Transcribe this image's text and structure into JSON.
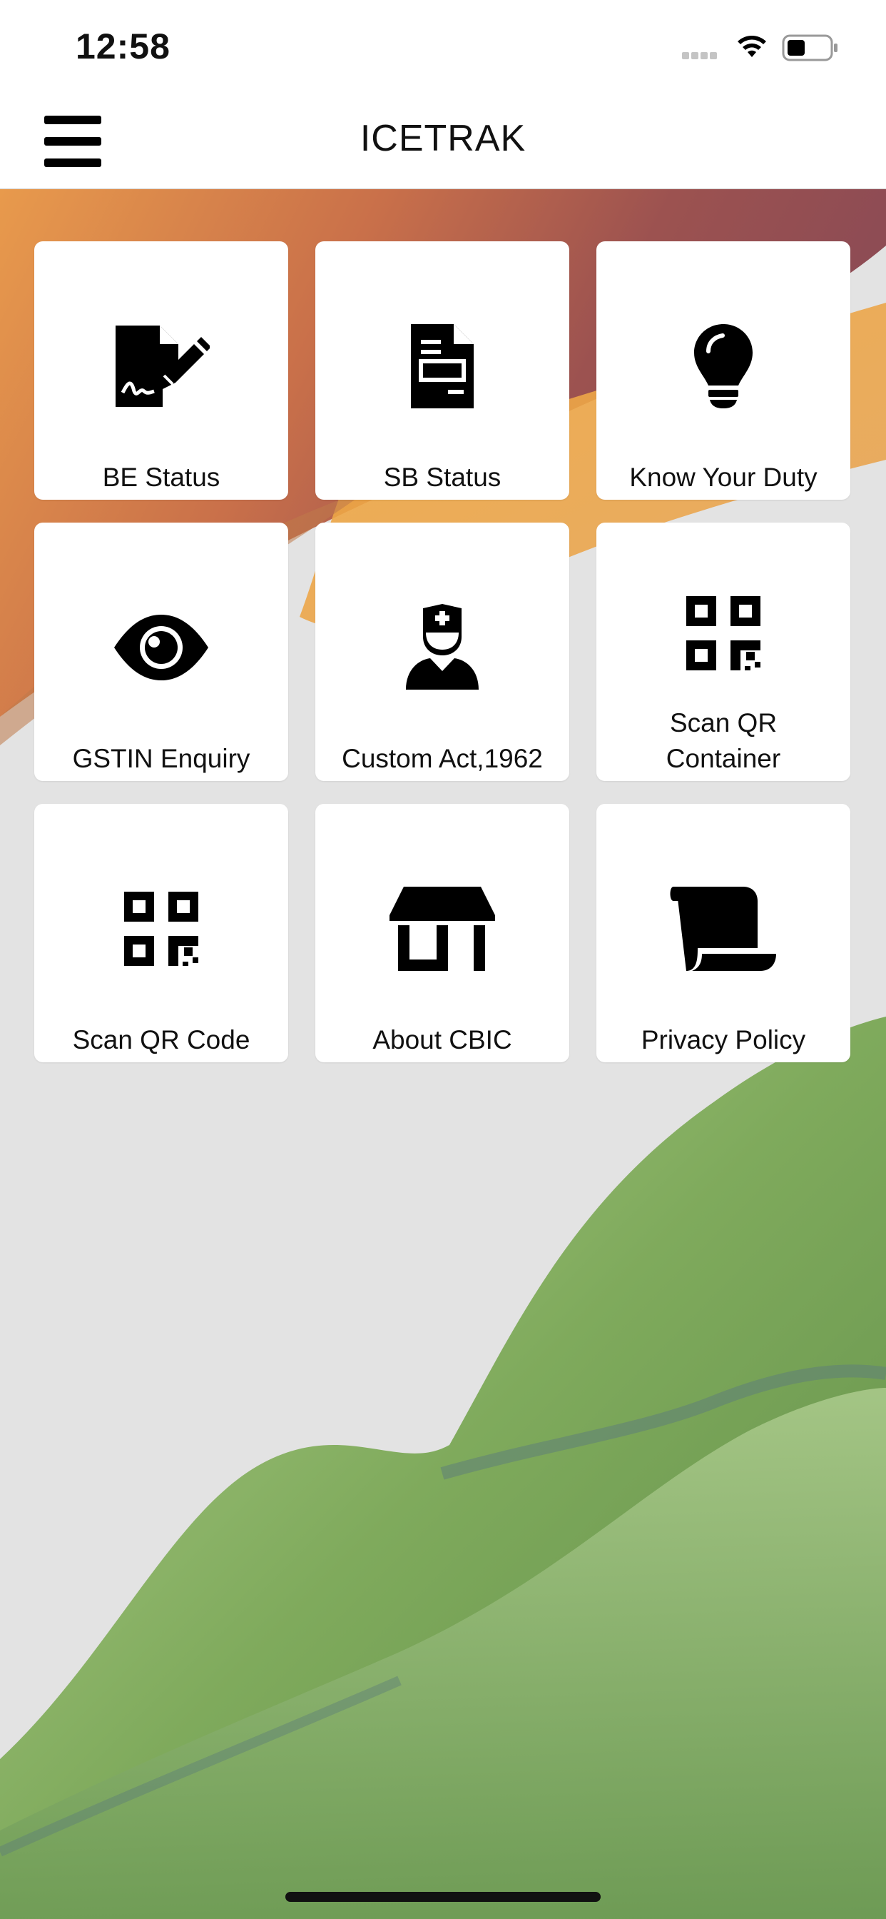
{
  "status_bar": {
    "time": "12:58"
  },
  "header": {
    "title": "ICETRAK"
  },
  "tiles": [
    {
      "label": "BE Status",
      "icon": "file-signature-icon"
    },
    {
      "label": "SB Status",
      "icon": "document-icon"
    },
    {
      "label": "Know Your Duty",
      "icon": "lightbulb-icon"
    },
    {
      "label": "GSTIN Enquiry",
      "icon": "eye-icon"
    },
    {
      "label": "Custom Act,1962",
      "icon": "user-nurse-icon"
    },
    {
      "label": "Scan QR Container",
      "icon": "qrcode-icon"
    },
    {
      "label": "Scan QR Code",
      "icon": "qrcode-icon"
    },
    {
      "label": "About CBIC",
      "icon": "store-icon"
    },
    {
      "label": "Privacy Policy",
      "icon": "scroll-icon"
    }
  ],
  "colors": {
    "header_bg": "#ffffff",
    "tile_bg": "#ffffff",
    "accent_saffron": "#e38a2a",
    "accent_green": "#6a9b4a"
  }
}
